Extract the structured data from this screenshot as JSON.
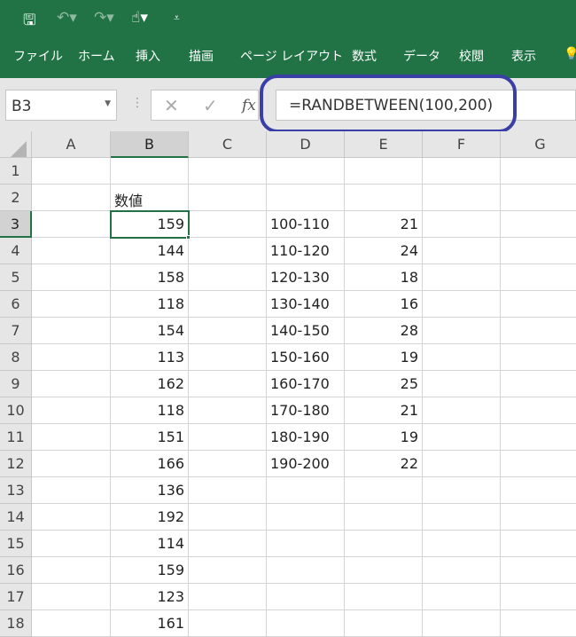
{
  "quick_access": {
    "save_icon": "save-icon",
    "undo_icon": "undo-icon",
    "redo_icon": "redo-icon",
    "touch_icon": "touch-mode-icon",
    "customize_icon": "customize-icon"
  },
  "ribbon_tabs": [
    "ファイル",
    "ホーム",
    "挿入",
    "描画",
    "ページ レイアウト",
    "数式",
    "データ",
    "校閲",
    "表示"
  ],
  "name_box": "B3",
  "formula": "=RANDBETWEEN(100,200)",
  "formula_buttons": {
    "cancel": "✕",
    "enter": "✓",
    "fx": "fx"
  },
  "annotation_color": "#3a3fa8",
  "accent": "#217346",
  "columns": [
    "A",
    "B",
    "C",
    "D",
    "E",
    "F",
    "G"
  ],
  "selected_cell": "B3",
  "rows": [
    {
      "n": "1",
      "B": "",
      "D": "",
      "E": ""
    },
    {
      "n": "2",
      "B": "数値",
      "D": "",
      "E": ""
    },
    {
      "n": "3",
      "B": "159",
      "D": "100-110",
      "E": "21"
    },
    {
      "n": "4",
      "B": "144",
      "D": "110-120",
      "E": "24"
    },
    {
      "n": "5",
      "B": "158",
      "D": "120-130",
      "E": "18"
    },
    {
      "n": "6",
      "B": "118",
      "D": "130-140",
      "E": "16"
    },
    {
      "n": "7",
      "B": "154",
      "D": "140-150",
      "E": "28"
    },
    {
      "n": "8",
      "B": "113",
      "D": "150-160",
      "E": "19"
    },
    {
      "n": "9",
      "B": "162",
      "D": "160-170",
      "E": "25"
    },
    {
      "n": "10",
      "B": "118",
      "D": "170-180",
      "E": "21"
    },
    {
      "n": "11",
      "B": "151",
      "D": "180-190",
      "E": "19"
    },
    {
      "n": "12",
      "B": "166",
      "D": "190-200",
      "E": "22"
    },
    {
      "n": "13",
      "B": "136",
      "D": "",
      "E": ""
    },
    {
      "n": "14",
      "B": "192",
      "D": "",
      "E": ""
    },
    {
      "n": "15",
      "B": "114",
      "D": "",
      "E": ""
    },
    {
      "n": "16",
      "B": "159",
      "D": "",
      "E": ""
    },
    {
      "n": "17",
      "B": "123",
      "D": "",
      "E": ""
    },
    {
      "n": "18",
      "B": "161",
      "D": "",
      "E": ""
    }
  ]
}
